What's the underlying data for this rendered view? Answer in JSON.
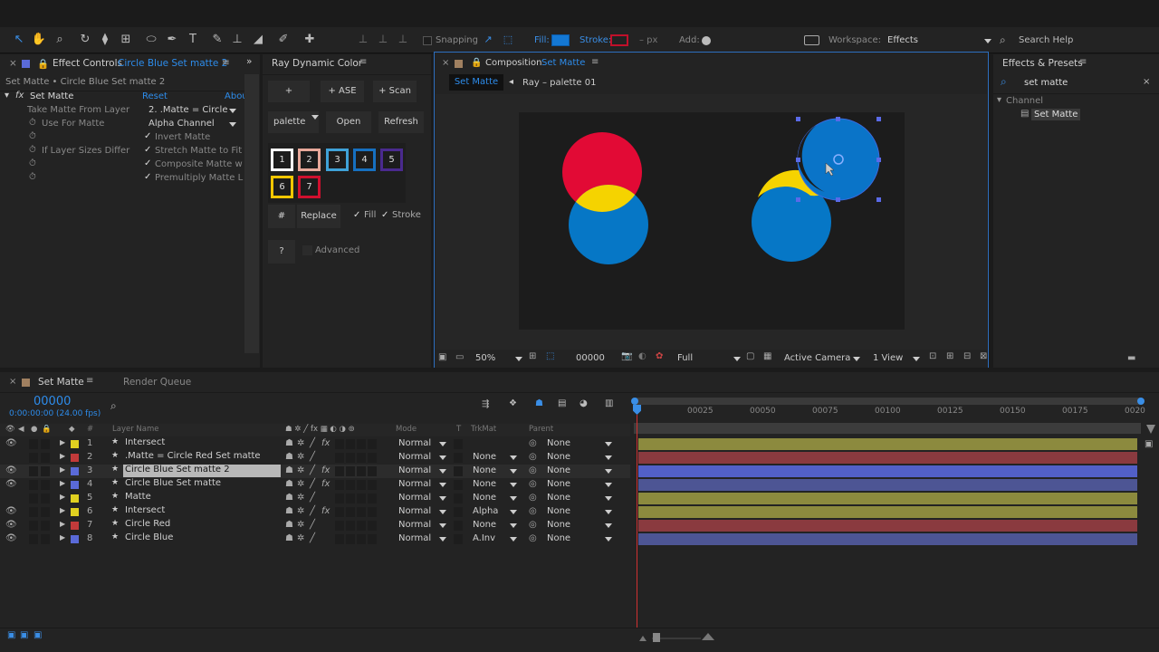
{
  "toolbar": {
    "snapping_label": "Snapping",
    "fill_label": "Fill:",
    "stroke_label": "Stroke:",
    "px_label": "– px",
    "add_label": "Add:",
    "workspace_label": "Workspace:",
    "workspace_value": "Effects",
    "search_help": "Search Help",
    "fill_color": "#1478d4",
    "stroke_color": "#c0102a"
  },
  "effect_controls": {
    "tab_title": "Effect Controls",
    "tab_layer": "Circle Blue Set matte 2",
    "breadcrumb": "Set Matte • Circle Blue Set matte 2",
    "effect_name": "Set Matte",
    "reset": "Reset",
    "about": "Abou",
    "props": [
      {
        "label": "Take Matte From Layer",
        "value": "2. .Matte = Circle"
      },
      {
        "label": "Use For Matte",
        "value": "Alpha Channel"
      },
      {
        "label": "",
        "value": "Invert Matte"
      },
      {
        "label": "If Layer Sizes Differ",
        "value": "Stretch Matte to Fit"
      },
      {
        "label": "",
        "value": "Composite Matte w"
      },
      {
        "label": "",
        "value": "Premultiply Matte L"
      }
    ]
  },
  "ray": {
    "title": "Ray Dynamic Color",
    "btn_plus": "+",
    "btn_ase": "+ ASE",
    "btn_scan": "+ Scan",
    "palette": "palette",
    "open": "Open",
    "refresh": "Refresh",
    "swatches": [
      {
        "n": "1",
        "color": "#ffffff"
      },
      {
        "n": "2",
        "color": "#e8a89a"
      },
      {
        "n": "3",
        "color": "#3fa2d8"
      },
      {
        "n": "4",
        "color": "#1670c0"
      },
      {
        "n": "5",
        "color": "#4a2a8e"
      },
      {
        "n": "6",
        "color": "#f2c600"
      },
      {
        "n": "7",
        "color": "#d0102e"
      }
    ],
    "hash": "#",
    "replace": "Replace",
    "fill": "Fill",
    "stroke": "Stroke",
    "help": "?",
    "advanced": "Advanced"
  },
  "composition": {
    "title": "Composition",
    "comp_name": "Set Matte",
    "crumb_active": "Set Matte",
    "crumb_next": "Ray – palette 01",
    "zoom": "50%",
    "timecode": "00000",
    "resolution": "Full",
    "camera": "Active Camera",
    "views": "1 View"
  },
  "effects_presets": {
    "title": "Effects & Presets",
    "search_value": "set matte",
    "category": "Channel",
    "item": "Set Matte"
  },
  "timeline": {
    "tab": "Set Matte",
    "render_queue": "Render Queue",
    "timecode": "00000",
    "timecode_sub": "0:00:00:00 (24.00 fps)",
    "cols": {
      "layer_name": "Layer Name",
      "mode": "Mode",
      "t": "T",
      "trkmat": "TrkMat",
      "parent": "Parent"
    },
    "ruler": [
      "00025",
      "00050",
      "00075",
      "00100",
      "00125",
      "00150",
      "00175",
      "0020"
    ],
    "layers": [
      {
        "num": "1",
        "label_color": "#e0d020",
        "name": "Intersect",
        "mode": "Normal",
        "trkmat": "",
        "parent": "None",
        "fx": true,
        "bar": "#8c8a3e"
      },
      {
        "num": "2",
        "label_color": "#c23a3a",
        "name": ".Matte = Circle Red Set matte",
        "mode": "Normal",
        "trkmat": "None",
        "parent": "None",
        "fx": false,
        "bar": "#8a3a3f"
      },
      {
        "num": "3",
        "label_color": "#5a6ad8",
        "name": "Circle Blue Set matte 2",
        "mode": "Normal",
        "trkmat": "None",
        "parent": "None",
        "fx": true,
        "bar": "#5260c8"
      },
      {
        "num": "4",
        "label_color": "#5a6ad8",
        "name": "Circle Blue Set matte",
        "mode": "Normal",
        "trkmat": "None",
        "parent": "None",
        "fx": true,
        "bar": "#4d5594"
      },
      {
        "num": "5",
        "label_color": "#e0d020",
        "name": "Matte",
        "mode": "Normal",
        "trkmat": "None",
        "parent": "None",
        "fx": false,
        "bar": "#8c8a3e"
      },
      {
        "num": "6",
        "label_color": "#e0d020",
        "name": "Intersect",
        "mode": "Normal",
        "trkmat": "Alpha",
        "parent": "None",
        "fx": true,
        "bar": "#8c8a3e"
      },
      {
        "num": "7",
        "label_color": "#c23a3a",
        "name": "Circle Red",
        "mode": "Normal",
        "trkmat": "None",
        "parent": "None",
        "fx": false,
        "bar": "#8a3a3f"
      },
      {
        "num": "8",
        "label_color": "#5a6ad8",
        "name": "Circle Blue",
        "mode": "Normal",
        "trkmat": "A.Inv",
        "parent": "None",
        "fx": false,
        "bar": "#4d5594"
      }
    ]
  }
}
